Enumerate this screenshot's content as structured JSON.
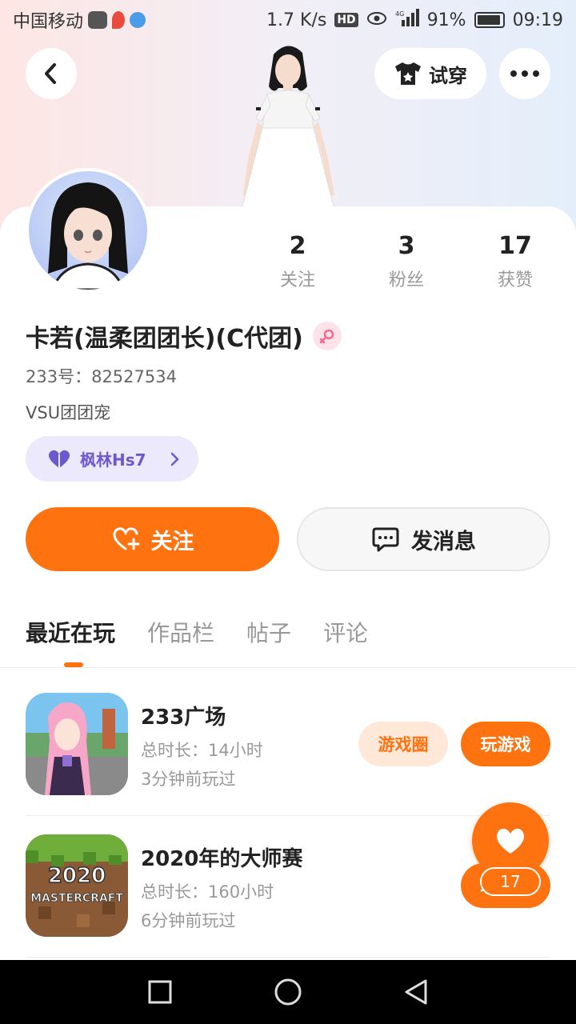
{
  "status_bar": {
    "carrier": "中国移动",
    "speed": "1.7 K/s",
    "hd": "HD",
    "battery": "91%",
    "time": "09:19"
  },
  "header": {
    "tryon_label": "试穿"
  },
  "profile": {
    "stats": [
      {
        "value": "2",
        "label": "关注"
      },
      {
        "value": "3",
        "label": "粉丝"
      },
      {
        "value": "17",
        "label": "获赞"
      }
    ],
    "nickname": "卡若(温柔团团长)(C代团)",
    "uid": "233号：82527534",
    "bio": "VSU团团宠",
    "cp_name": "枫林Hs7"
  },
  "actions": {
    "follow_label": "关注",
    "message_label": "发消息"
  },
  "tabs": [
    {
      "label": "最近在玩"
    },
    {
      "label": "作品栏"
    },
    {
      "label": "帖子"
    },
    {
      "label": "评论"
    }
  ],
  "games": [
    {
      "title": "233广场",
      "duration": "总时长：14小时",
      "last_played": "3分钟前玩过",
      "circle_label": "游戏圈",
      "play_label": "玩游戏"
    },
    {
      "title": "2020年的大师赛",
      "duration": "总时长：160小时",
      "last_played": "6分钟前玩过",
      "play_label": "玩游戏",
      "icon_text_top": "2020",
      "icon_text_bottom": "MASTERCRAFT"
    }
  ],
  "like_fab": {
    "count": "17"
  },
  "colors": {
    "accent": "#ff7210",
    "chip_bg": "#ffe8d8",
    "cp_chip": "#ebe9fb"
  }
}
